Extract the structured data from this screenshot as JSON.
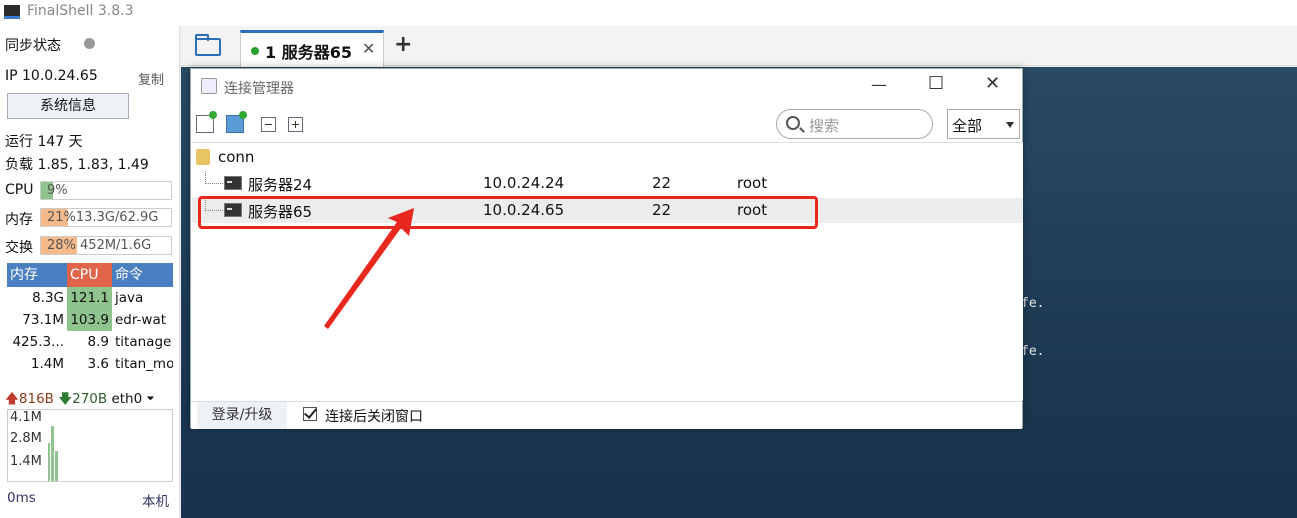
{
  "app": {
    "title": "FinalShell 3.8.3"
  },
  "sidebar": {
    "sync_label": "同步状态",
    "ip_label": "IP 10.0.24.65",
    "copy_label": "复制",
    "sysinfo_label": "系统信息",
    "uptime": "运行 147 天",
    "load": "负载 1.85, 1.83, 1.49",
    "meters": [
      {
        "label": "CPU",
        "text": "9%",
        "percent": 9,
        "color": "#8fc48f"
      },
      {
        "label": "内存",
        "text": "21%13.3G/62.9G",
        "percent": 21,
        "color": "#f5b98a"
      },
      {
        "label": "交换",
        "text": "28%  452M/1.6G",
        "percent": 28,
        "color": "#f5b98a"
      }
    ],
    "proc_headers": [
      "内存",
      "CPU",
      "命令"
    ],
    "proc_header_colors": [
      "#4a7fc1",
      "#e0654a",
      "#4a7fc1"
    ],
    "processes": [
      {
        "mem": "8.3G",
        "cpu": "121.1",
        "cmd": "java"
      },
      {
        "mem": "73.1M",
        "cpu": "103.9",
        "cmd": "edr-wat"
      },
      {
        "mem": "425.3...",
        "cpu": "8.9",
        "cmd": "titanage"
      },
      {
        "mem": "1.4M",
        "cpu": "3.6",
        "cmd": "titan_mo"
      }
    ],
    "net": {
      "up": "816B",
      "down": "270B",
      "iface": "eth0"
    },
    "graph_labels": [
      "4.1M",
      "2.8M",
      "1.4M"
    ],
    "latency": "0ms",
    "local_label": "本机"
  },
  "tabs": [
    {
      "index": "1",
      "label": "服务器65"
    }
  ],
  "terminal": {
    "lines": [
      "fe.",
      "fe."
    ]
  },
  "dialog": {
    "title": "连接管理器",
    "search_placeholder": "搜索",
    "filter_value": "全部",
    "folder": "conn",
    "connections": [
      {
        "name": "服务器24",
        "host": "10.0.24.24",
        "port": "22",
        "user": "root"
      },
      {
        "name": "服务器65",
        "host": "10.0.24.65",
        "port": "22",
        "user": "root"
      }
    ],
    "login_label": "登录/升级",
    "close_after_connect": "连接后关闭窗口"
  },
  "colors": {
    "accent": "#2d6fb8",
    "highlight": "#e8281f",
    "online": "#2ca02c"
  }
}
